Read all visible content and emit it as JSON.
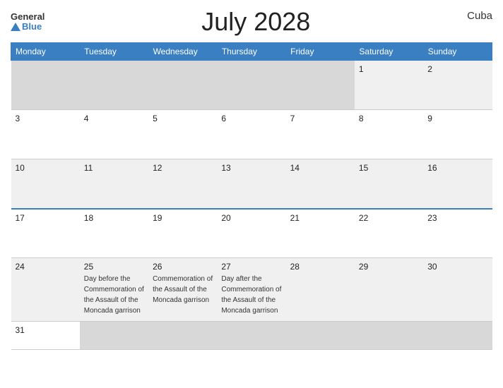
{
  "header": {
    "logo_general": "General",
    "logo_blue": "Blue",
    "title": "July 2028",
    "country": "Cuba"
  },
  "days_of_week": [
    "Monday",
    "Tuesday",
    "Wednesday",
    "Thursday",
    "Friday",
    "Saturday",
    "Sunday"
  ],
  "weeks": [
    {
      "days": [
        {
          "number": "",
          "event": ""
        },
        {
          "number": "",
          "event": ""
        },
        {
          "number": "",
          "event": ""
        },
        {
          "number": "",
          "event": ""
        },
        {
          "number": "",
          "event": ""
        },
        {
          "number": "1",
          "event": ""
        },
        {
          "number": "2",
          "event": ""
        }
      ]
    },
    {
      "days": [
        {
          "number": "3",
          "event": ""
        },
        {
          "number": "4",
          "event": ""
        },
        {
          "number": "5",
          "event": ""
        },
        {
          "number": "6",
          "event": ""
        },
        {
          "number": "7",
          "event": ""
        },
        {
          "number": "8",
          "event": ""
        },
        {
          "number": "9",
          "event": ""
        }
      ]
    },
    {
      "days": [
        {
          "number": "10",
          "event": ""
        },
        {
          "number": "11",
          "event": ""
        },
        {
          "number": "12",
          "event": ""
        },
        {
          "number": "13",
          "event": ""
        },
        {
          "number": "14",
          "event": ""
        },
        {
          "number": "15",
          "event": ""
        },
        {
          "number": "16",
          "event": ""
        }
      ]
    },
    {
      "days": [
        {
          "number": "17",
          "event": ""
        },
        {
          "number": "18",
          "event": ""
        },
        {
          "number": "19",
          "event": ""
        },
        {
          "number": "20",
          "event": ""
        },
        {
          "number": "21",
          "event": ""
        },
        {
          "number": "22",
          "event": ""
        },
        {
          "number": "23",
          "event": ""
        }
      ]
    },
    {
      "days": [
        {
          "number": "24",
          "event": ""
        },
        {
          "number": "25",
          "event": "Day before the Commemoration of the Assault of the Moncada garrison"
        },
        {
          "number": "26",
          "event": "Commemoration of the Assault of the Moncada garrison"
        },
        {
          "number": "27",
          "event": "Day after the Commemoration of the Assault of the Moncada garrison"
        },
        {
          "number": "28",
          "event": ""
        },
        {
          "number": "29",
          "event": ""
        },
        {
          "number": "30",
          "event": ""
        }
      ]
    },
    {
      "days": [
        {
          "number": "31",
          "event": ""
        },
        {
          "number": "",
          "event": ""
        },
        {
          "number": "",
          "event": ""
        },
        {
          "number": "",
          "event": ""
        },
        {
          "number": "",
          "event": ""
        },
        {
          "number": "",
          "event": ""
        },
        {
          "number": "",
          "event": ""
        }
      ]
    }
  ]
}
